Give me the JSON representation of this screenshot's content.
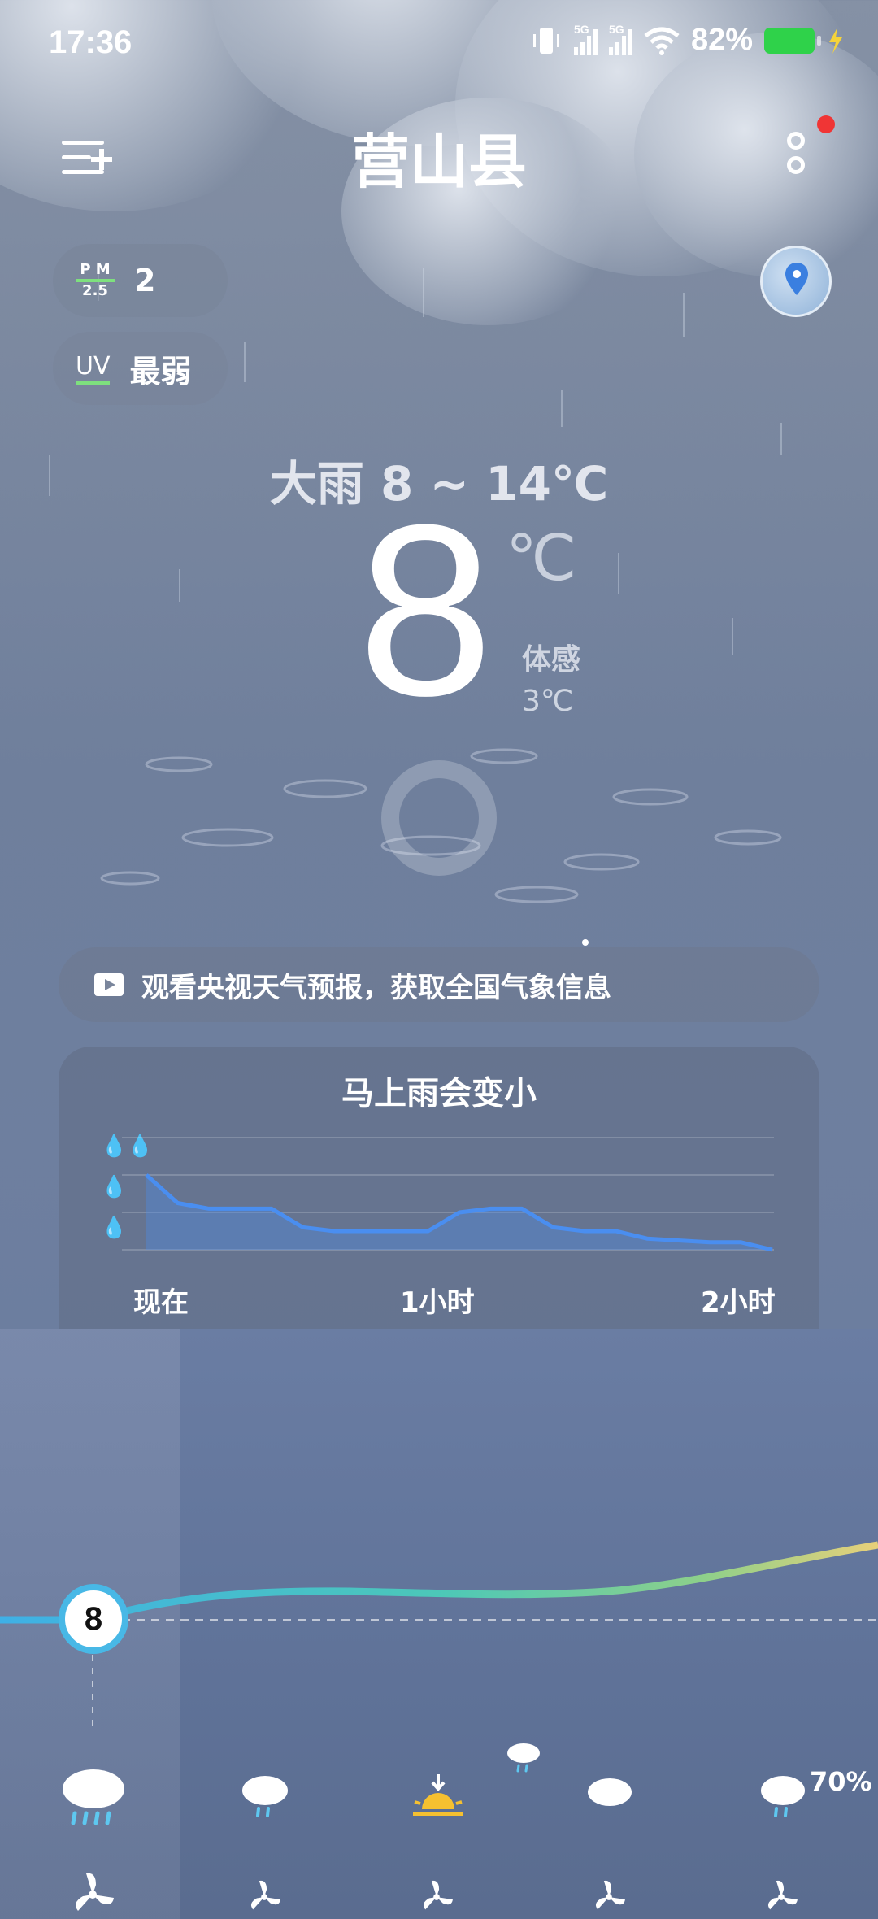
{
  "status_bar": {
    "time": "17:36",
    "battery": "82%",
    "network": [
      "5G",
      "5G"
    ]
  },
  "header": {
    "city": "营山县"
  },
  "air": {
    "pm_top": "P M",
    "pm_bottom": "2.5",
    "pm_value": "2",
    "uv_label": "UV",
    "uv_value": "最弱"
  },
  "current": {
    "summary": "大雨  8 ~ 14℃",
    "temp": "8",
    "unit": "℃",
    "feels_label": "体感",
    "feels_value": "3℃"
  },
  "banner": {
    "text": "观看央视天气预报，获取全国气象信息"
  },
  "rain_card": {
    "title": "马上雨会变小",
    "labels": [
      "现在",
      "1小时",
      "2小时"
    ]
  },
  "chart_data": {
    "type": "area",
    "title": "马上雨会变小",
    "xlabel": "",
    "ylabel": "",
    "x_tick_labels": [
      "现在",
      "1小时",
      "2小时"
    ],
    "x_minutes": [
      0,
      10,
      20,
      40,
      50,
      60,
      80,
      90,
      100,
      110,
      120,
      130,
      140,
      150,
      160,
      180,
      190,
      200
    ],
    "values": [
      2.0,
      1.25,
      1.1,
      1.1,
      0.6,
      0.5,
      0.5,
      0.5,
      1.0,
      1.1,
      1.1,
      0.6,
      0.5,
      0.5,
      0.3,
      0.2,
      0.2,
      0.0
    ],
    "ylim": [
      0,
      3
    ],
    "y_levels": [
      "小雨",
      "中雨",
      "大雨"
    ],
    "color": "#4a8ef0"
  },
  "hourly": {
    "current_temp": "8",
    "precip_pct": "70%",
    "icons": [
      "heavy-rain-icon",
      "light-rain-icon",
      "sunset-icon",
      "cloudy-icon",
      "light-rain-icon"
    ],
    "wind_icons": [
      "wind-icon",
      "wind-icon",
      "wind-icon",
      "wind-icon",
      "wind-icon"
    ]
  },
  "colors": {
    "accent": "#4a8ef0",
    "temp_curve_start": "#3fb0e6",
    "temp_curve_end": "#e8d07a",
    "notification": "#f03535"
  }
}
